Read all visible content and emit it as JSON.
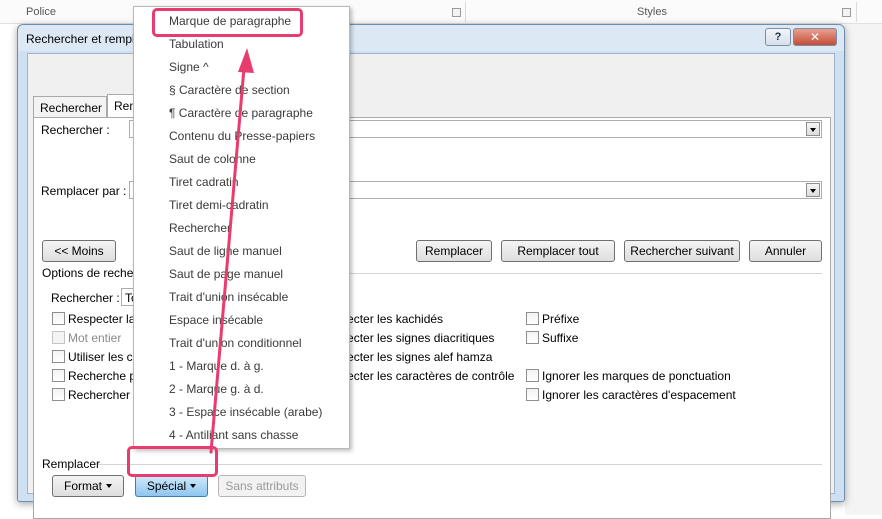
{
  "ribbon": {
    "group_left": "Police",
    "group_right": "Styles"
  },
  "dialog": {
    "title": "Rechercher et remplacer",
    "help_label": "?",
    "close_label": "✕",
    "tabs": [
      "Rechercher",
      "Remplacer"
    ],
    "find_label": "Rechercher :",
    "replace_label": "Remplacer par :",
    "less_button": "<< Moins",
    "replace_button": "Remplacer",
    "replace_all_button": "Remplacer tout",
    "find_next_button": "Rechercher suivant",
    "cancel_button": "Annuler",
    "options_label": "Options de recherche",
    "search_label": "Rechercher :",
    "search_value": "Tout",
    "left_options": [
      {
        "label": "Respecter la casse",
        "disabled": false
      },
      {
        "label": "Mot entier",
        "disabled": true
      },
      {
        "label": "Utiliser les caractères génériques",
        "disabled": false
      },
      {
        "label": "Recherche phonétique",
        "disabled": false
      },
      {
        "label": "Rechercher toutes les formes du mot",
        "disabled": false
      }
    ],
    "middle_options": [
      "Respecter les kachidés",
      "Respecter les signes diacritiques",
      "Respecter les signes alef hamza",
      "Respecter les caractères de contrôle"
    ],
    "right_options": [
      "Préfixe",
      "Suffixe",
      "Ignorer les marques de ponctuation",
      "Ignorer les caractères d'espacement"
    ],
    "replace_section_label": "Remplacer",
    "format_button": "Format",
    "special_button": "Spécial",
    "no_attributes_button": "Sans attributs"
  },
  "special_menu": [
    "Marque de paragraphe",
    "Tabulation",
    "Signe ^",
    "§ Caractère de section",
    "¶ Caractère de paragraphe",
    "Contenu du Presse-papiers",
    "Saut de colonne",
    "Tiret cadratin",
    "Tiret demi-cadratin",
    "Rechercher",
    "Saut de ligne manuel",
    "Saut de page manuel",
    "Trait d'union insécable",
    "Espace insécable",
    "Trait d'union conditionnel",
    "1 - Marque d. à g.",
    "2 - Marque g. à d.",
    "3 - Espace insécable (arabe)",
    "4 - Antiliant sans chasse"
  ],
  "colors": {
    "highlight": "#e83b6e",
    "dialog_frame": "#cfe0f2"
  }
}
